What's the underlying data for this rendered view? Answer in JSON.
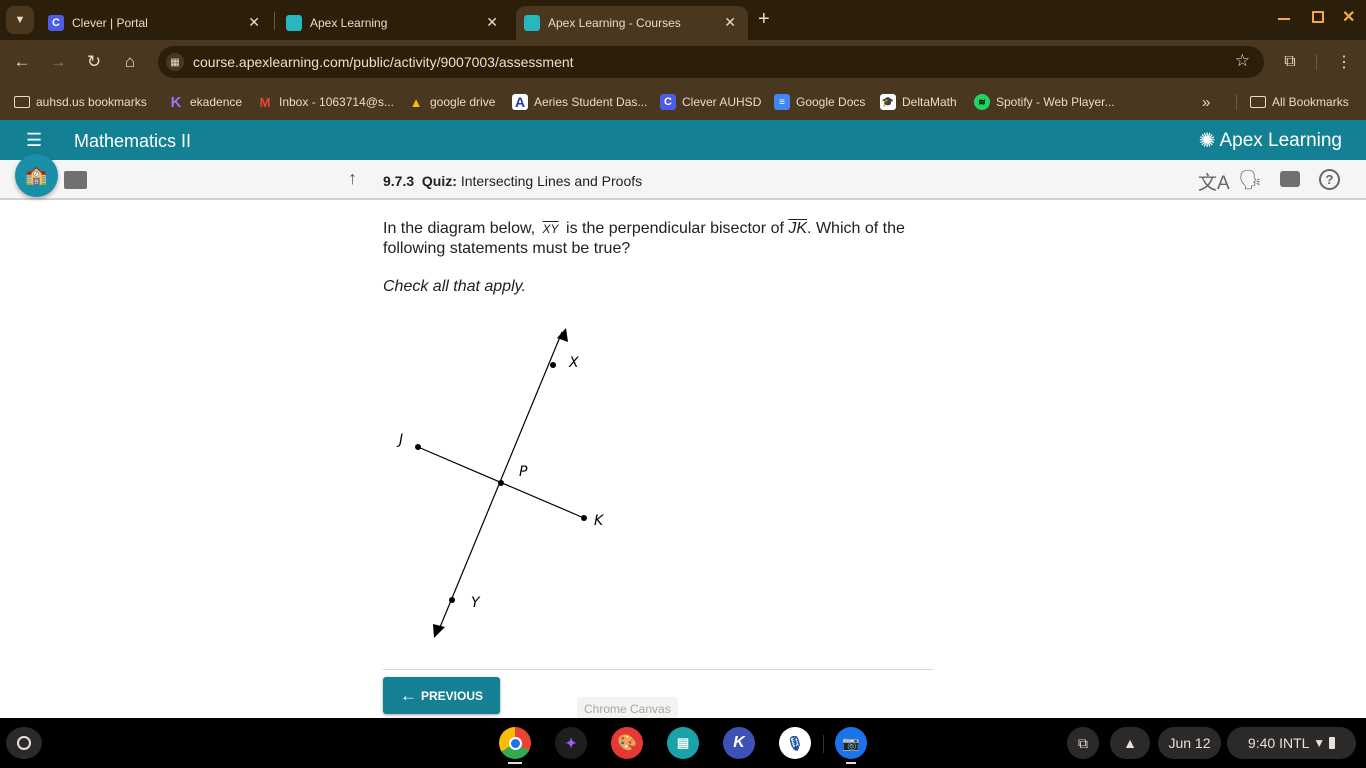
{
  "browser": {
    "tabs": [
      {
        "title": "Clever | Portal",
        "icon": "clever-icon",
        "active": false
      },
      {
        "title": "Apex Learning",
        "icon": "apex-icon",
        "active": false
      },
      {
        "title": "Apex Learning - Courses",
        "icon": "apex-icon",
        "active": true
      }
    ],
    "new_tab": "+",
    "url": "course.apexlearning.com/public/activity/9007003/assessment",
    "bookmarks": [
      {
        "label": "auhsd.us bookmarks",
        "icon": "folder-icon"
      },
      {
        "label": "ekadence",
        "icon": "kadence-icon"
      },
      {
        "label": "Inbox - 1063714@s...",
        "icon": "gmail-icon"
      },
      {
        "label": "google drive",
        "icon": "drive-icon"
      },
      {
        "label": "Aeries Student Das...",
        "icon": "aeries-icon"
      },
      {
        "label": "Clever AUHSD",
        "icon": "clever-icon"
      },
      {
        "label": "Google Docs",
        "icon": "docs-icon"
      },
      {
        "label": "DeltaMath",
        "icon": "deltamath-icon"
      },
      {
        "label": "Spotify - Web Player...",
        "icon": "spotify-icon"
      }
    ],
    "overflow": "»",
    "all_bookmarks": "All Bookmarks"
  },
  "apex": {
    "course_title": "Mathematics II",
    "brand": "Apex Learning",
    "activity_number": "9.7.3",
    "activity_type": "Quiz:",
    "activity_title": "Intersecting Lines and Proofs",
    "colors": {
      "header": "#148094",
      "button": "#148094"
    }
  },
  "question": {
    "text_part1": "In the diagram below,",
    "line_symbol": "XY",
    "text_part2": "is the perpendicular bisector of",
    "segment_symbol": "JK",
    "text_part3": ". Which of the following statements must be true?",
    "instruction": "Check all that apply."
  },
  "diagram": {
    "labels": {
      "X": "X",
      "Y": "Y",
      "J": "J",
      "K": "K",
      "P": "P"
    }
  },
  "nav": {
    "previous": "PREVIOUS",
    "tooltip": "Chrome Canvas"
  },
  "shelf": {
    "date": "Jun 12",
    "time": "9:40",
    "input": "INTL"
  }
}
